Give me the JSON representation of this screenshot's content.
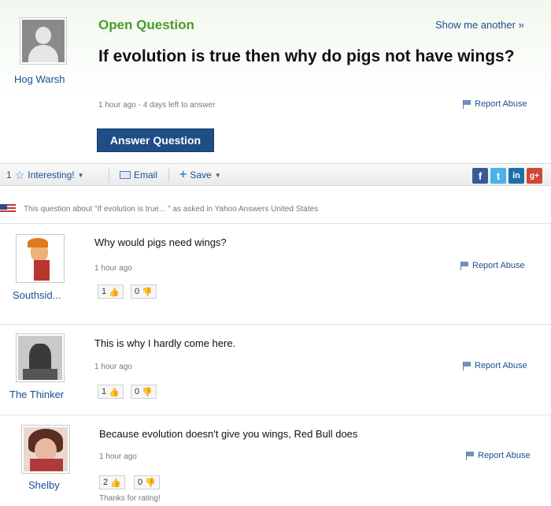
{
  "question_header": {
    "label": "Open Question",
    "show_another": "Show me another »",
    "text": "If evolution is true then why do pigs not have wings?",
    "meta": "1 hour ago - 4 days left to answer",
    "report": "Report Abuse",
    "answer_button": "Answer Question"
  },
  "asker": {
    "name": "Hog Warsh"
  },
  "toolbar": {
    "interesting_count": "1",
    "interesting": "Interesting!",
    "email": "Email",
    "save": "Save",
    "social": [
      "f",
      "t",
      "in",
      "g+"
    ]
  },
  "about": "This question about \"If evolution is true... \" as asked in Yahoo Answers United States",
  "answers": [
    {
      "user": "Southsid...",
      "text": "Why would pigs need wings?",
      "time": "1 hour ago",
      "up": "1",
      "down": "0",
      "report": "Report Abuse"
    },
    {
      "user": "The Thinker",
      "text": "This is why I hardly come here.",
      "time": "1 hour ago",
      "up": "1",
      "down": "0",
      "report": "Report Abuse"
    },
    {
      "user": "Shelby",
      "text": "Because evolution doesn't give you wings, Red Bull does",
      "time": "1 hour ago",
      "up": "2",
      "down": "0",
      "report": "Report Abuse",
      "note": "Thanks for rating!"
    }
  ],
  "colors": {
    "accent_green": "#4a9a2c",
    "link_blue": "#1c4f8f",
    "button_blue": "#1f4d86"
  }
}
